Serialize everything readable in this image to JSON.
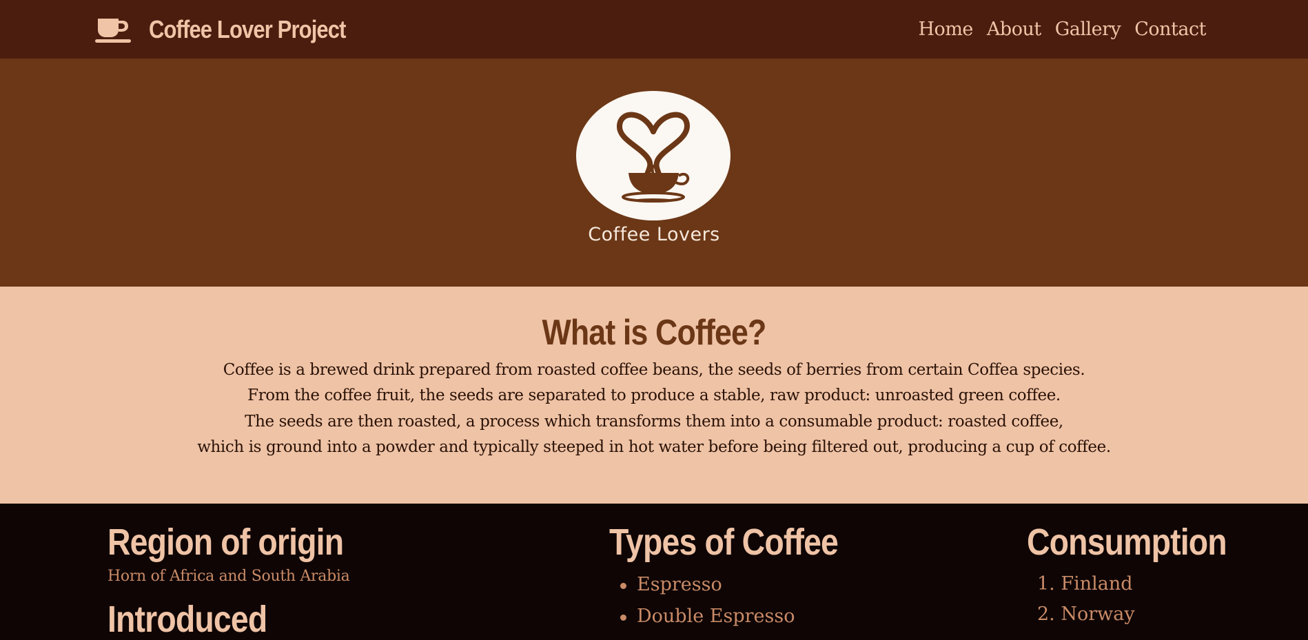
{
  "navbar": {
    "brand_icon": "coffee-cup-icon",
    "title": "Coffee Lover Project",
    "links": [
      "Home",
      "About",
      "Gallery",
      "Contact"
    ]
  },
  "hero": {
    "logo_icon": "heart-steam-coffee-cup-logo",
    "logo_text": "Coffee Lovers"
  },
  "about": {
    "heading": "What is Coffee?",
    "lines": [
      "Coffee is a brewed drink prepared from roasted coffee beans, the seeds of berries from certain Coffea species.",
      "From the coffee fruit, the seeds are separated to produce a stable, raw product: unroasted green coffee.",
      "The seeds are then roasted, a process which transforms them into a consumable product: roasted coffee,",
      "which is ground into a powder and typically steeped in hot water before being filtered out, producing a cup of coffee."
    ]
  },
  "info": {
    "origin": {
      "heading": "Region of origin",
      "text": "Horn of Africa and South Arabia",
      "next_heading": "Introduced"
    },
    "types": {
      "heading": "Types of Coffee",
      "items": [
        "Espresso",
        "Double Espresso"
      ]
    },
    "consumption": {
      "heading": "Consumption",
      "items": [
        "1. Finland",
        "2. Norway"
      ]
    }
  },
  "colors": {
    "navbar_bg": "#4a1d0f",
    "hero_bg": "#6b3716",
    "about_bg": "#efc3a6",
    "info_bg": "#0f0505",
    "accent": "#efc3a6",
    "muted_text": "#c98b67"
  }
}
